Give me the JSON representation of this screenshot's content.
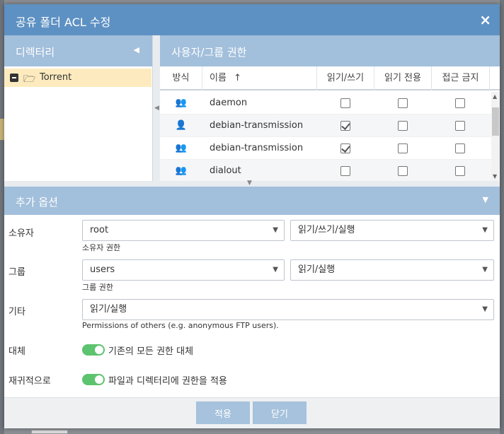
{
  "dialog": {
    "title": "공유 폴더 ACL 수정",
    "close_icon": "×"
  },
  "left_pane": {
    "header": "디렉터리",
    "collapse_icon": "◀",
    "tree": [
      {
        "label": "Torrent",
        "expanded": true,
        "selected": true
      }
    ]
  },
  "right_pane": {
    "header": "사용자/그룹 권한",
    "columns": {
      "type": "방식",
      "name": "이름",
      "sort_icon": "↑",
      "rw": "읽기/쓰기",
      "ro": "읽기 전용",
      "deny": "접근 금지"
    },
    "rows": [
      {
        "icon": "group-icon",
        "name": "daemon",
        "rw": false,
        "ro": false,
        "deny": false
      },
      {
        "icon": "user-icon",
        "name": "debian-transmission",
        "rw": true,
        "ro": false,
        "deny": false
      },
      {
        "icon": "group-icon",
        "name": "debian-transmission",
        "rw": true,
        "ro": false,
        "deny": false
      },
      {
        "icon": "group-icon",
        "name": "dialout",
        "rw": false,
        "ro": false,
        "deny": false
      }
    ]
  },
  "options": {
    "header": "추가 옵션",
    "owner": {
      "label": "소유자",
      "value": "root",
      "perm": "읽기/쓰기/실행",
      "hint": "소유자 권한"
    },
    "group": {
      "label": "그룹",
      "value": "users",
      "perm": "읽기/실행",
      "hint": "그룹 권한"
    },
    "other": {
      "label": "기타",
      "perm": "읽기/실행",
      "hint": "Permissions of others (e.g. anonymous FTP users)."
    },
    "replace": {
      "label": "대체",
      "toggle_label": "기존의 모든 권한 대체",
      "on": true
    },
    "recursive": {
      "label": "재귀적으로",
      "toggle_label": "파일과 디렉터리에 권한을 적용",
      "on": true
    }
  },
  "footer": {
    "apply": "적용",
    "close": "닫기"
  },
  "colors": {
    "titlebar": "#5e91c3",
    "section_header": "#a2bfdb",
    "selected_row": "#fdebbf",
    "toggle_on": "#5cc36e",
    "button": "#a6c2dc"
  }
}
